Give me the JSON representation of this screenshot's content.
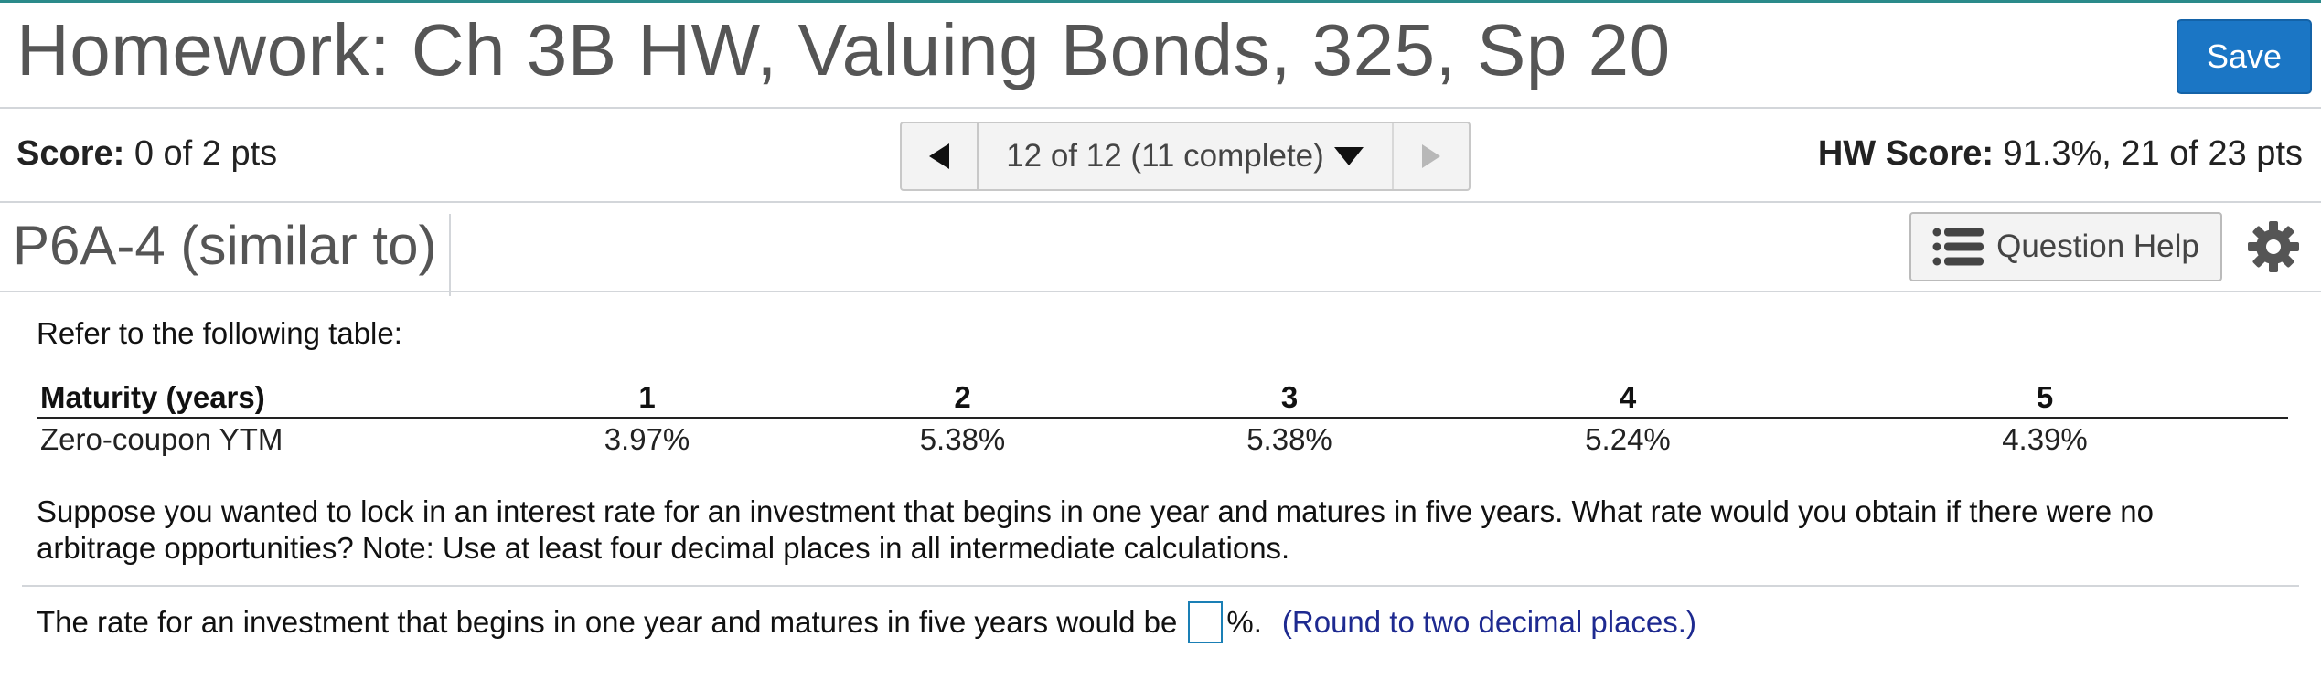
{
  "header": {
    "title": "Homework: Ch 3B HW, Valuing Bonds, 325, Sp 20",
    "save_label": "Save"
  },
  "score_bar": {
    "score_label": "Score:",
    "score_value": "0 of 2 pts",
    "nav_label": "12 of 12 (11 complete)",
    "hw_score_label": "HW Score:",
    "hw_score_value": "91.3%, 21 of 23 pts"
  },
  "question_bar": {
    "question_id": "P6A-4 (similar to)",
    "help_label": "Question Help"
  },
  "content": {
    "intro": "Refer to the following table:",
    "table": {
      "header": [
        "Maturity (years)",
        "1",
        "2",
        "3",
        "4",
        "5"
      ],
      "row_label": "Zero-coupon YTM",
      "row_values": [
        "3.97%",
        "5.38%",
        "5.38%",
        "5.24%",
        "4.39%"
      ]
    },
    "question": "Suppose you wanted to lock in an interest rate for an investment that begins in one year and matures in five years. What rate would you obtain if there were no arbitrage opportunities?  Note: Use at least four decimal places in all intermediate calculations.",
    "answer_prefix": "The rate for an investment that begins in one year and matures in five years would be",
    "answer_suffix": "%.",
    "round_hint": "(Round to two decimal places.)"
  },
  "colors": {
    "accent": "#1b76c5",
    "hint": "#1e2a90",
    "top_rule": "#2a8a8a"
  },
  "icons": [
    "left-triangle-icon",
    "dropdown-triangle-icon",
    "right-triangle-icon",
    "list-icon",
    "gear-icon"
  ]
}
